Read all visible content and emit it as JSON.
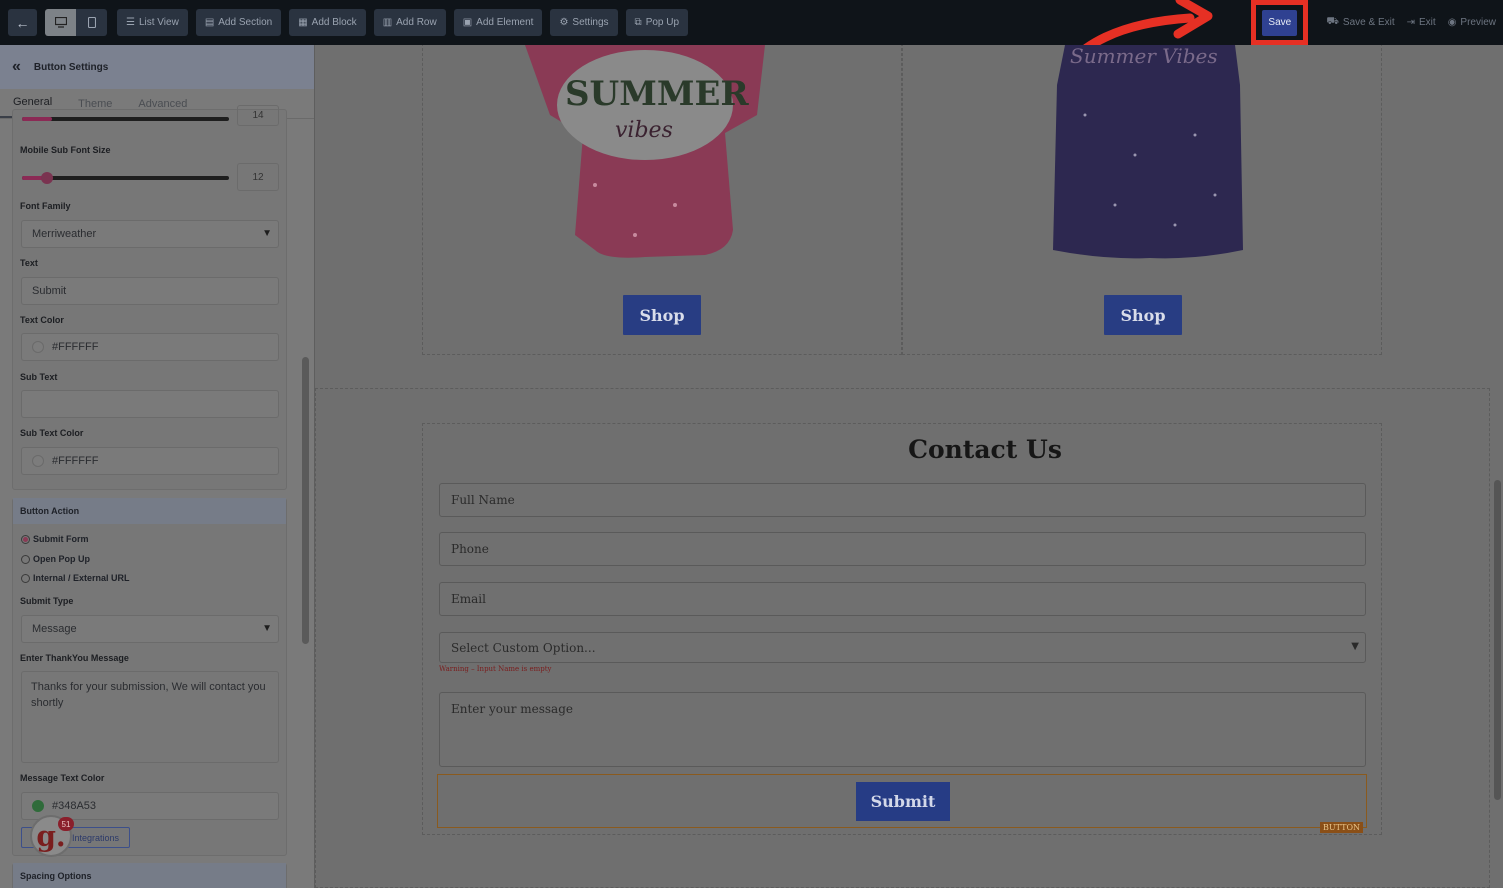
{
  "toolbar": {
    "back_icon": "arrow-left-icon",
    "devices": [
      "desktop-icon",
      "mobile-icon"
    ],
    "items": [
      {
        "label": "List View",
        "icon": "list-icon"
      },
      {
        "label": "Add Section",
        "icon": "section-icon"
      },
      {
        "label": "Add Block",
        "icon": "block-icon"
      },
      {
        "label": "Add Row",
        "icon": "row-icon"
      },
      {
        "label": "Add Element",
        "icon": "element-icon"
      },
      {
        "label": "Settings",
        "icon": "settings-icon"
      },
      {
        "label": "Pop Up",
        "icon": "popup-icon"
      }
    ],
    "save": "Save",
    "save_exit": "Save & Exit",
    "exit": "Exit",
    "preview": "Preview",
    "highlight_color": "#e63024"
  },
  "sidebar": {
    "title": "Button Settings",
    "tabs": [
      "General",
      "Theme",
      "Advanced"
    ],
    "prev_font_size": "14",
    "mobile_sub_font_size_label": "Mobile Sub Font Size",
    "mobile_sub_font_size": "12",
    "mobile_sub_font_size_level": 0.12,
    "font_family_label": "Font Family",
    "font_family": "Merriweather",
    "text_label": "Text",
    "text": "Submit",
    "text_color_label": "Text Color",
    "text_color": "#FFFFFF",
    "sub_text_label": "Sub Text",
    "sub_text": "",
    "sub_text_color_label": "Sub Text Color",
    "sub_text_color": "#FFFFFF",
    "button_action_label": "Button Action",
    "actions": [
      "Submit Form",
      "Open Pop Up",
      "Internal / External URL"
    ],
    "selected_action": "Submit Form",
    "submit_type_label": "Submit Type",
    "submit_type": "Message",
    "thankyou_label": "Enter ThankYou Message",
    "thankyou_message": "Thanks for your submission, We will contact you shortly",
    "message_text_color_label": "Message Text Color",
    "message_text_color": "#348A53",
    "integrations": "Integrations",
    "spacing_label": "Spacing Options",
    "badge_letter": "g.",
    "badge_count": "51"
  },
  "canvas": {
    "products": [
      {
        "button": "Shop"
      },
      {
        "button": "Shop"
      }
    ],
    "contact": {
      "title": "Contact Us",
      "fields": [
        "Full Name",
        "Phone",
        "Email"
      ],
      "select_placeholder": "Select Custom Option...",
      "warning": "Warning – Input Name is empty",
      "message_placeholder": "Enter your message",
      "submit": "Submit",
      "tag": "BUTTON"
    }
  }
}
